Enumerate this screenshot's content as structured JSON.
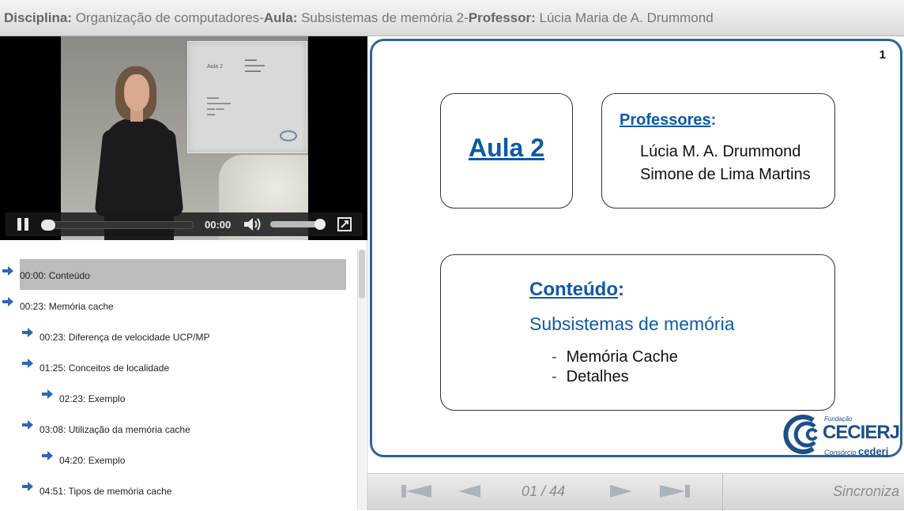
{
  "header": {
    "disciplina_label": "Disciplina:",
    "disciplina_value": "Organização de computadores",
    "sep1": " - ",
    "aula_label": "Aula:",
    "aula_value": "Subsistemas de memória 2",
    "sep2": " - ",
    "professor_label": "Professor:",
    "professor_value": "Lúcia Maria de A. Drummond"
  },
  "player": {
    "time": "00:00",
    "icons": [
      "pause-icon",
      "volume-icon",
      "fullscreen-icon"
    ],
    "board_title": "Aula 2"
  },
  "playlist": {
    "items": [
      {
        "label": "00:00: Conteúdo",
        "level": 0,
        "active": true
      },
      {
        "label": "00:23: Memória cache",
        "level": 0
      },
      {
        "label": "00:23: Diferença de velocidade UCP/MP",
        "level": 1
      },
      {
        "label": "01:25: Conceitos de localidade",
        "level": 1
      },
      {
        "label": "02:23: Exemplo",
        "level": 2
      },
      {
        "label": "03:08: Utilização da memória cache",
        "level": 1
      },
      {
        "label": "04:20: Exemplo",
        "level": 2
      },
      {
        "label": "04:51: Tipos de memória cache",
        "level": 1
      }
    ]
  },
  "slide": {
    "number": "1",
    "aula_title": "Aula 2",
    "professores_label": "Professores",
    "colon": ":",
    "professores": [
      "Lúcia M.  A. Drummond",
      "Simone de Lima Martins"
    ],
    "conteudo_label": "Conteúdo",
    "conteudo_subtitle": "Subsistemas de memória",
    "conteudo_items": [
      "Memória Cache",
      "Detalhes"
    ],
    "dash": "-",
    "logo": {
      "fundacao": "Fundação",
      "name": "CECIERJ",
      "consorcio": "Consórcio",
      "cederj": "cederj"
    }
  },
  "nav": {
    "page_indicator": "01 / 44",
    "sync_label": "Sincroniza",
    "icon_color": "#a9b4bd"
  }
}
